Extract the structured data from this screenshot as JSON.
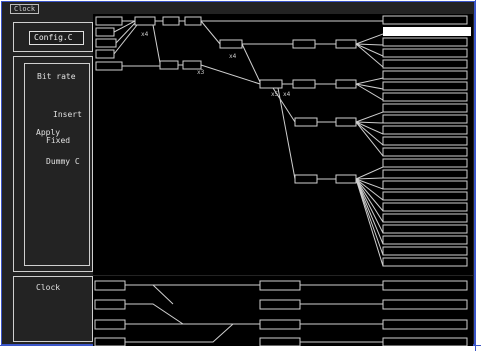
{
  "window": {
    "title": "Clock"
  },
  "config_button": {
    "label": "Config.C"
  },
  "left_labels": {
    "bit_rate": "Bit rate",
    "insert": "Insert",
    "apply": "Apply",
    "fixed": "Fixed",
    "dummy": "Dummy C",
    "clock": "Clock"
  },
  "node_labels": {
    "a": "x4",
    "b": "x3",
    "c": "x5",
    "d": "x4",
    "e": "x4"
  },
  "colors": {
    "accent": "#3a55c8",
    "selected": "#ffffff",
    "canvas": "#000000",
    "panel": "#232323"
  }
}
